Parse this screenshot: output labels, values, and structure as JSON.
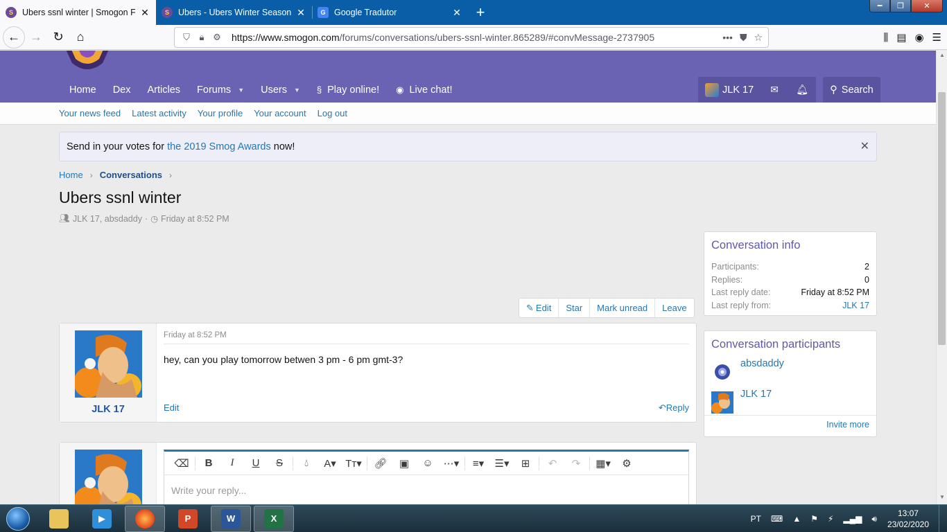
{
  "browser": {
    "tabs": [
      {
        "title": "Ubers ssnl winter | Smogon Forums",
        "active": true,
        "favicon": "smogon-icon"
      },
      {
        "title": "Ubers - Ubers Winter Seasonal I",
        "active": false,
        "favicon": "smogon-icon"
      },
      {
        "title": "Google Tradutor",
        "active": false,
        "favicon": "google-translate-icon"
      }
    ],
    "new_tab": "+",
    "url_host": "https://www.smogon.com",
    "url_path": "/forums/conversations/ubers-ssnl-winter.865289/#convMessage-2737905",
    "more_icon": "•••"
  },
  "site": {
    "nav": {
      "home": "Home",
      "dex": "Dex",
      "articles": "Articles",
      "forums": "Forums",
      "users": "Users",
      "play": "Play online!",
      "chat": "Live chat!"
    },
    "user": {
      "name": "JLK 17",
      "search": "Search"
    },
    "subnav": [
      "Your news feed",
      "Latest activity",
      "Your profile",
      "Your account",
      "Log out"
    ],
    "notice": {
      "pre": "Send in your votes for ",
      "link": "the 2019 Smog Awards",
      "post": " now!",
      "close": "✕"
    },
    "breadcrumb": {
      "home": "Home",
      "conversations": "Conversations"
    },
    "title": "Ubers ssnl winter",
    "meta": {
      "participants": "JLK 17, absdaddy",
      "sep": "·",
      "date": "Friday at 8:52 PM"
    },
    "actions": {
      "edit": "Edit",
      "star": "Star",
      "mark_unread": "Mark unread",
      "leave": "Leave"
    },
    "message": {
      "author": "JLK 17",
      "date": "Friday at 8:52 PM",
      "body": "hey, can you play tomorrow betwen 3 pm - 6 pm gmt-3?",
      "edit": "Edit",
      "reply": "Reply"
    },
    "reply_box": {
      "placeholder": "Write your reply..."
    },
    "info": {
      "title": "Conversation info",
      "rows": [
        {
          "k": "Participants:",
          "v": "2"
        },
        {
          "k": "Replies:",
          "v": "0"
        },
        {
          "k": "Last reply date:",
          "v": "Friday at 8:52 PM"
        },
        {
          "k": "Last reply from:",
          "v": "JLK 17"
        }
      ]
    },
    "participants": {
      "title": "Conversation participants",
      "list": [
        "absdaddy",
        "JLK 17"
      ],
      "invite": "Invite more"
    }
  },
  "taskbar": {
    "lang": "PT",
    "time": "13:07",
    "date": "23/02/2020",
    "apps": [
      "explorer",
      "media-player",
      "firefox",
      "powerpoint",
      "word",
      "excel"
    ]
  },
  "colors": {
    "header": "#6a62b2",
    "link": "#2577b1",
    "tabbar": "#0a5ea8"
  }
}
